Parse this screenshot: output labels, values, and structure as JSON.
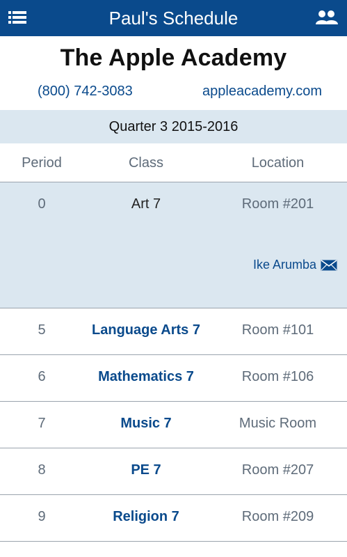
{
  "app": {
    "title": "Paul's Schedule"
  },
  "school": {
    "name": "The Apple Academy",
    "phone": "(800) 742-3083",
    "website": "appleacademy.com"
  },
  "term": "Quarter 3 2015-2016",
  "table": {
    "headers": {
      "period": "Period",
      "class": "Class",
      "location": "Location"
    },
    "rows": [
      {
        "period": "0",
        "class": "Art 7",
        "location": "Room #201",
        "teacher": "Ike Arumba",
        "expanded": true
      },
      {
        "period": "5",
        "class": "Language Arts 7",
        "location": "Room #101"
      },
      {
        "period": "6",
        "class": "Mathematics 7",
        "location": "Room #106"
      },
      {
        "period": "7",
        "class": "Music 7",
        "location": "Music Room"
      },
      {
        "period": "8",
        "class": "PE 7",
        "location": "Room #207"
      },
      {
        "period": "9",
        "class": "Religion 7",
        "location": "Room #209"
      }
    ]
  },
  "icons": {
    "menu": "hamburger-menu-icon",
    "people": "people-icon",
    "mail": "envelope-icon"
  },
  "colors": {
    "brand": "#0a4a8c",
    "highlight": "#dbe7f0",
    "muted": "#5e6b79"
  }
}
